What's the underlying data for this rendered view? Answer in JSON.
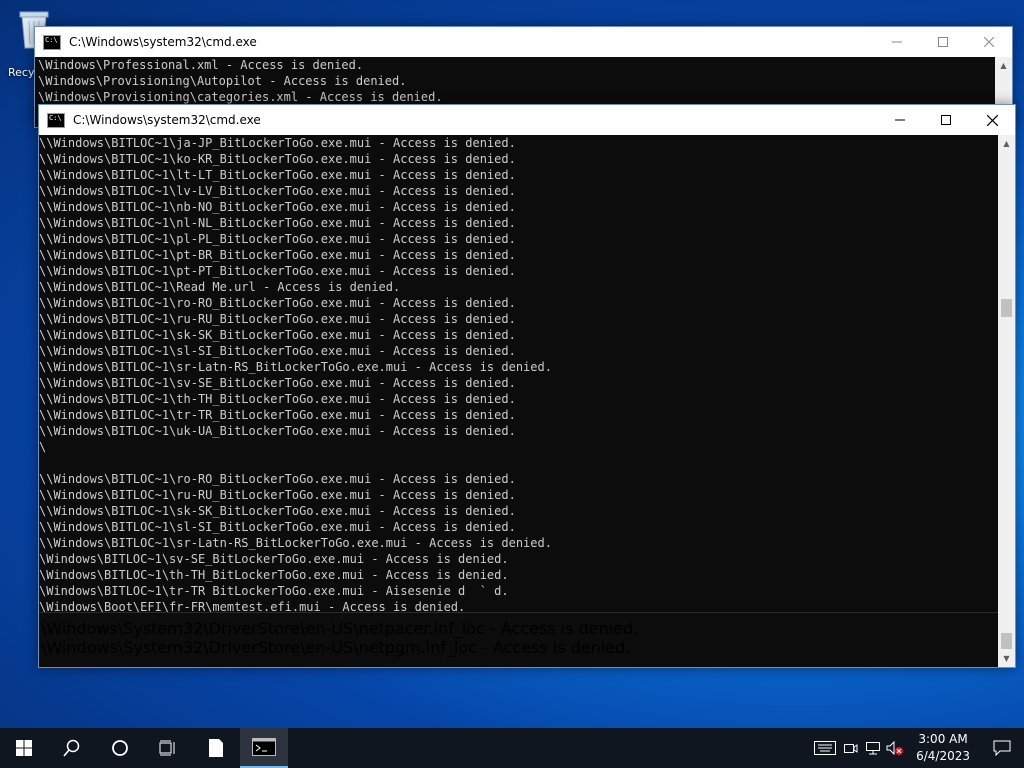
{
  "desktop": {
    "recycle_bin_label": "Recy"
  },
  "back_window": {
    "title": "C:\\Windows\\system32\\cmd.exe",
    "lines": [
      "\\Windows\\Professional.xml - Access is denied.",
      "\\Windows\\Provisioning\\Autopilot - Access is denied.",
      "\\Windows\\Provisioning\\categories.xml - Access is denied."
    ]
  },
  "front_window": {
    "title": "C:\\Windows\\system32\\cmd.exe",
    "lines": [
      "\\\\Windows\\BITLOC~1\\ja-JP_BitLockerToGo.exe.mui - Access is denied.",
      "\\\\Windows\\BITLOC~1\\ko-KR_BitLockerToGo.exe.mui - Access is denied.",
      "\\\\Windows\\BITLOC~1\\lt-LT_BitLockerToGo.exe.mui - Access is denied.",
      "\\\\Windows\\BITLOC~1\\lv-LV_BitLockerToGo.exe.mui - Access is denied.",
      "\\\\Windows\\BITLOC~1\\nb-NO_BitLockerToGo.exe.mui - Access is denied.",
      "\\\\Windows\\BITLOC~1\\nl-NL_BitLockerToGo.exe.mui - Access is denied.",
      "\\\\Windows\\BITLOC~1\\pl-PL_BitLockerToGo.exe.mui - Access is denied.",
      "\\\\Windows\\BITLOC~1\\pt-BR_BitLockerToGo.exe.mui - Access is denied.",
      "\\\\Windows\\BITLOC~1\\pt-PT_BitLockerToGo.exe.mui - Access is denied.",
      "\\\\Windows\\BITLOC~1\\Read Me.url - Access is denied.",
      "\\\\Windows\\BITLOC~1\\ro-RO_BitLockerToGo.exe.mui - Access is denied.",
      "\\\\Windows\\BITLOC~1\\ru-RU_BitLockerToGo.exe.mui - Access is denied.",
      "\\\\Windows\\BITLOC~1\\sk-SK_BitLockerToGo.exe.mui - Access is denied.",
      "\\\\Windows\\BITLOC~1\\sl-SI_BitLockerToGo.exe.mui - Access is denied.",
      "\\\\Windows\\BITLOC~1\\sr-Latn-RS_BitLockerToGo.exe.mui - Access is denied.",
      "\\\\Windows\\BITLOC~1\\sv-SE_BitLockerToGo.exe.mui - Access is denied.",
      "\\\\Windows\\BITLOC~1\\th-TH_BitLockerToGo.exe.mui - Access is denied.",
      "\\\\Windows\\BITLOC~1\\tr-TR_BitLockerToGo.exe.mui - Access is denied.",
      "\\\\Windows\\BITLOC~1\\uk-UA_BitLockerToGo.exe.mui - Access is denied.",
      "\\",
      "",
      "\\\\Windows\\BITLOC~1\\ro-RO_BitLockerToGo.exe.mui - Access is denied.",
      "\\\\Windows\\BITLOC~1\\ru-RU_BitLockerToGo.exe.mui - Access is denied.",
      "\\\\Windows\\BITLOC~1\\sk-SK_BitLockerToGo.exe.mui - Access is denied.",
      "\\\\Windows\\BITLOC~1\\sl-SI_BitLockerToGo.exe.mui - Access is denied.",
      "\\\\Windows\\BITLOC~1\\sr-Latn-RS_BitLockerToGo.exe.mui - Access is denied.",
      "\\Windows\\BITLOC~1\\sv-SE_BitLockerToGo.exe.mui - Access is denied.",
      "\\Windows\\BITLOC~1\\th-TH_BitLockerToGo.exe.mui - Access is denied.",
      "\\Windows\\BITLOC~1\\tr-TR BitLockerToGo.exe.mui - Aisesenie d  ` d.",
      "\\Windows\\Boot\\EFI\\fr-FR\\memtest.efi.mui - Access is denied."
    ],
    "overflow_lines": [
      "\\Windows\\System32\\DriverStore\\en-US\\netpacer.inf_loc - Access is denied.",
      "\\Windows\\System32\\DriverStore\\en-US\\netpgm.inf_loc - Access is denied."
    ]
  },
  "taskbar": {
    "clock_time": "3:00 AM",
    "clock_date": "6/4/2023"
  },
  "colors": {
    "console_bg": "#0c0c0c",
    "console_text": "#cccccc",
    "taskbar_bg": "#101620",
    "accent": "#76b9ed"
  }
}
